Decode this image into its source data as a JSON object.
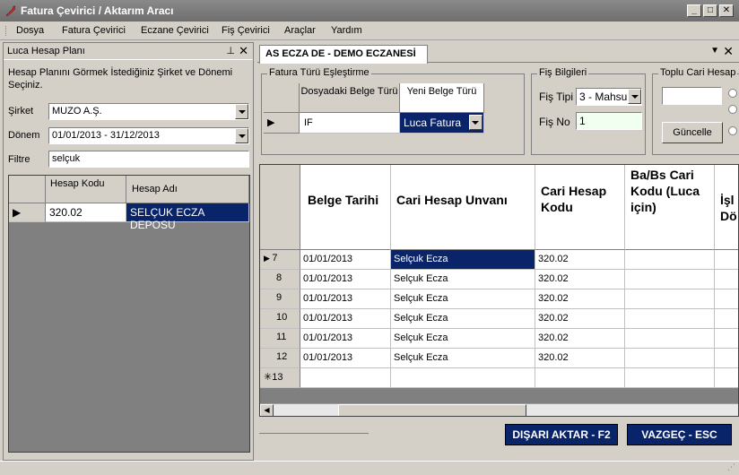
{
  "window": {
    "title": "Fatura Çevirici / Aktarım Aracı"
  },
  "menu": [
    "Dosya",
    "Fatura Çevirici",
    "Eczane Çevirici",
    "Fiş Çevirici",
    "Araçlar",
    "Yardım"
  ],
  "left_panel": {
    "title": "Luca Hesap Planı",
    "info": "Hesap Planını Görmek İstediğiniz Şirket ve Dönemi Seçiniz.",
    "sirket_label": "Şirket",
    "sirket_value": "MUZO A.Ş.",
    "donem_label": "Dönem",
    "donem_value": "01/01/2013 - 31/12/2013",
    "filtre_label": "Filtre",
    "filtre_value": "selçuk",
    "grid": {
      "headers": [
        "Hesap Kodu",
        "Hesap Adı"
      ],
      "rows": [
        {
          "kod": "320.02",
          "ad": "SELÇUK ECZA DEPOSU"
        }
      ]
    }
  },
  "right_panel": {
    "tab_label": "AS ECZA DE - DEMO ECZANESİ",
    "fatura_turu": {
      "label": "Fatura Türü Eşleştirme",
      "col1": "Dosyadaki Belge Türü",
      "col2": "Yeni Belge Türü",
      "row": {
        "dosyadaki": "IF",
        "yeni": "Luca Fatura"
      }
    },
    "fis_bilgileri": {
      "label": "Fiş Bilgileri",
      "fis_tipi_label": "Fiş Tipi",
      "fis_tipi_value": "3 - Mahsu",
      "fis_no_label": "Fiş No",
      "fis_no_value": "1"
    },
    "toplu_cari": {
      "label": "Toplu Cari Hesap",
      "guncelle": "Güncelle"
    },
    "main_grid": {
      "headers": {
        "tarih": "Belge Tarihi",
        "unvan": "Cari Hesap Unvanı",
        "kod": "Cari Hesap Kodu",
        "babs": "Ba/Bs Cari Kodu (Luca için)",
        "islem": "İşl Dö"
      },
      "rows": [
        {
          "n": "7",
          "tarih": "01/01/2013",
          "unvan": "Selçuk Ecza",
          "kod": "320.02"
        },
        {
          "n": "8",
          "tarih": "01/01/2013",
          "unvan": "Selçuk Ecza",
          "kod": "320.02"
        },
        {
          "n": "9",
          "tarih": "01/01/2013",
          "unvan": "Selçuk Ecza",
          "kod": "320.02"
        },
        {
          "n": "10",
          "tarih": "01/01/2013",
          "unvan": "Selçuk Ecza",
          "kod": "320.02"
        },
        {
          "n": "11",
          "tarih": "01/01/2013",
          "unvan": "Selçuk Ecza",
          "kod": "320.02"
        },
        {
          "n": "12",
          "tarih": "01/01/2013",
          "unvan": "Selçuk Ecza",
          "kod": "320.02"
        }
      ],
      "new_row": "13"
    },
    "buttons": {
      "aktar": "DIŞARI AKTAR - F2",
      "vazgec": "VAZGEÇ - ESC"
    }
  },
  "colors": {
    "selection": "#0a246a",
    "chrome": "#d4d0c8"
  }
}
